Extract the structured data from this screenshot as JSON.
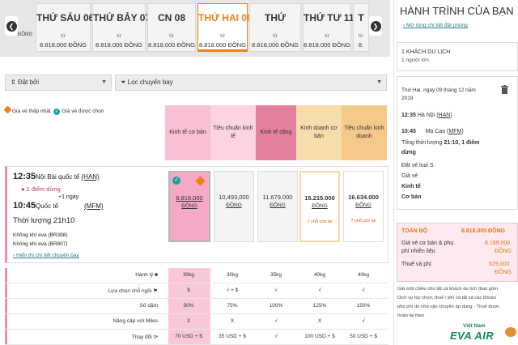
{
  "date_tabs": [
    {
      "day": "THỨ SÁU 06",
      "from": "từ",
      "price": "8.818.000 ĐỒNG",
      "selected": false
    },
    {
      "day": "THỨ BẢY 07",
      "from": "từ",
      "price": "8.818.000 ĐỒNG",
      "selected": false
    },
    {
      "day": "CN 08",
      "from": "từ",
      "price": "8.818.000 ĐỒNG",
      "selected": false
    },
    {
      "day": "THỨ HAI 09",
      "from": "từ",
      "price": "8.818.000 ĐỒNG",
      "selected": true
    },
    {
      "day": "THỨ",
      "from": "từ",
      "price": "8.818.000 ĐỒNG",
      "selected": false
    },
    {
      "day": "THỨ TƯ 11",
      "from": "từ",
      "price": "8.818.000 ĐỒNG",
      "selected": false
    },
    {
      "day": "T",
      "from": "từ",
      "price": "8.",
      "selected": false
    }
  ],
  "first_tab_partial": "ĐỒNG",
  "filters": {
    "stops": "Đặt bởi",
    "flight_list": "Lọc chuyến bay"
  },
  "legend": {
    "lowest": "Giá vé thấp nhất",
    "selected": "Giá vé được chọn"
  },
  "fare_classes": [
    {
      "name": "Kinh tế cơ bản",
      "color": "#f9bfd2"
    },
    {
      "name": "Tiêu chuẩn kinh tế",
      "color": "#f9bfd2"
    },
    {
      "name": "Kinh tế cộng",
      "color": "#e3809e"
    },
    {
      "name": "Kinh doanh cơ bản",
      "color": "#f8dcab"
    },
    {
      "name": "Tiêu chuẩn kinh doanh",
      "color": "#f4c98a"
    }
  ],
  "flight": {
    "dep_time": "12:35",
    "dep_airport": "Nội Bài quốc tế",
    "dep_code": "(HAN)",
    "stops": "1 điểm dừng",
    "next_day": "+1 ngày",
    "arr_time": "10:45",
    "arr_airport": "Quốc tế",
    "arr_code": "(MFM)",
    "duration": "Thời lượng 21h10",
    "op1": "Không khí eva (BR398)",
    "op2": "Không khí eva (BR807)",
    "details_link": "Hiển thị chi tiết chuyến bay"
  },
  "fares": [
    {
      "price": "8.818.000",
      "currency": "ĐỒNG",
      "seats": ""
    },
    {
      "price": "10,493,000",
      "currency": "ĐỒNG",
      "seats": ""
    },
    {
      "price": "11.679.000",
      "currency": "ĐỒNG",
      "seats": ""
    },
    {
      "price": "15.215.000",
      "currency": "ĐỒNG",
      "seats": "7 chỗ còn lại"
    },
    {
      "price": "16.634.000",
      "currency": "ĐỒNG",
      "seats": "7 chỗ còn lại"
    }
  ],
  "attributes": [
    {
      "label": "Hành lý",
      "values": [
        "30kg",
        "30kg",
        "35kg",
        "40kg",
        "40kg"
      ]
    },
    {
      "label": "Lựa chọn chỗ ngồi",
      "values": [
        "$",
        "√ + $",
        "√",
        "√",
        "√"
      ]
    },
    {
      "label": "Số dặm",
      "values": [
        "50%",
        "75%",
        "100%",
        "125%",
        "150%"
      ]
    },
    {
      "label": "Nâng cấp với Miles",
      "values": [
        "X",
        "X",
        "√",
        "X",
        "√"
      ]
    },
    {
      "label": "Thay đổi",
      "values": [
        "70 USD + $",
        "35 USD + $",
        "√",
        "100 USD + $",
        "50 USD + $"
      ]
    }
  ],
  "journey": {
    "title": "HÀNH TRÌNH CỦA BẠN",
    "expand_link": "Mở rộng chi tiết đặt phòng",
    "passenger_line1": "1 KHÁCH DU LỊCH",
    "passenger_line2": "1 người lớn",
    "date_line1": "Thứ Hai, ngày 09 tháng 12 năm",
    "date_line2": "2019",
    "dep_time": "12:35",
    "dep_city": "Hà Nội (",
    "dep_code": "HAN",
    "dep_close": ")",
    "arr_time": "10:45",
    "arr_city": "Ma Cao (",
    "arr_code": "MFM",
    "arr_close": ")",
    "total_time_label": "Tổng thời lượng",
    "total_time": "21:10, 1 điểm",
    "stops_word": "dừng",
    "fare_type_label": "Đặt vé loại S",
    "fare_label": "Giá vé",
    "fare_name_line1": "Kinh tế",
    "fare_name_line2": "Cơ bản"
  },
  "total": {
    "label": "TOÀN BỘ",
    "value": "8.818.000",
    "currency": "ĐỒNG",
    "base_label_1": "Giá vé cơ bản & phụ",
    "base_label_2": "phí nhiên liệu",
    "base_value": "8.189.000",
    "base_currency": "ĐỒNG",
    "tax_label": "Thuế và phí",
    "tax_value": "629.000",
    "tax_currency": "ĐỒNG"
  },
  "note": {
    "line1": "Giá một chiều cho tất cả khách du lịch (bao gồm",
    "line2": "Dịch vụ tùy chọn, thuế / phí và tất cả các khoản",
    "line3": "phụ phí do nhà vận chuyển áp dụng - Thuế được",
    "line4": "hoàn lại theo"
  },
  "watermark": {
    "line1": "Việt Nam",
    "line2": "EVA AIR"
  },
  "colors": {
    "accent": "#f08219",
    "pink": "#f5a9c6",
    "teal": "#1aa3a3"
  }
}
